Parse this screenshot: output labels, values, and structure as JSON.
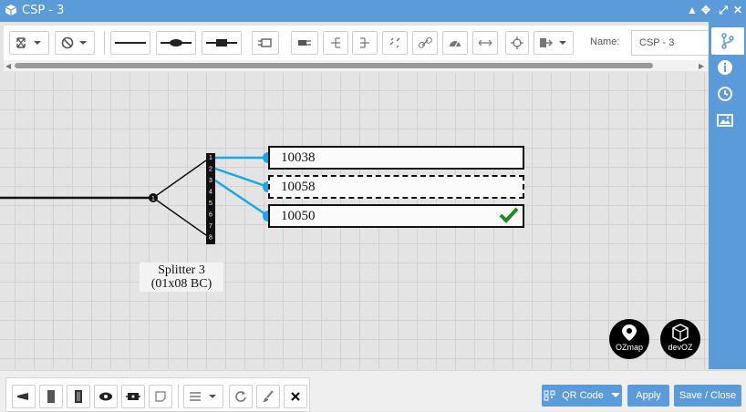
{
  "window": {
    "title": "CSP - 3"
  },
  "toolbar": {
    "name_label": "Name:",
    "name_value": "CSP - 3"
  },
  "diagram": {
    "splitter_label_line1": "Splitter 3",
    "splitter_label_line2": "(01x08 BC)",
    "input_port": "1",
    "output_ports": [
      "1",
      "2",
      "3",
      "4",
      "5",
      "6",
      "7",
      "8"
    ],
    "fibers": [
      {
        "label": "10038",
        "style": "solid",
        "checked": false
      },
      {
        "label": "10058",
        "style": "dashed",
        "checked": false
      },
      {
        "label": "10050",
        "style": "solid",
        "checked": true
      }
    ],
    "colors": {
      "connector": "#1aa7e8",
      "check": "#1e8c1e",
      "accent": "#5b9bd9"
    }
  },
  "logos": {
    "ozmap": "OZmap",
    "devoz": "devOZ"
  },
  "bottom": {
    "qr_label": "QR Code",
    "apply_label": "Apply",
    "save_close_label": "Save / Close"
  }
}
